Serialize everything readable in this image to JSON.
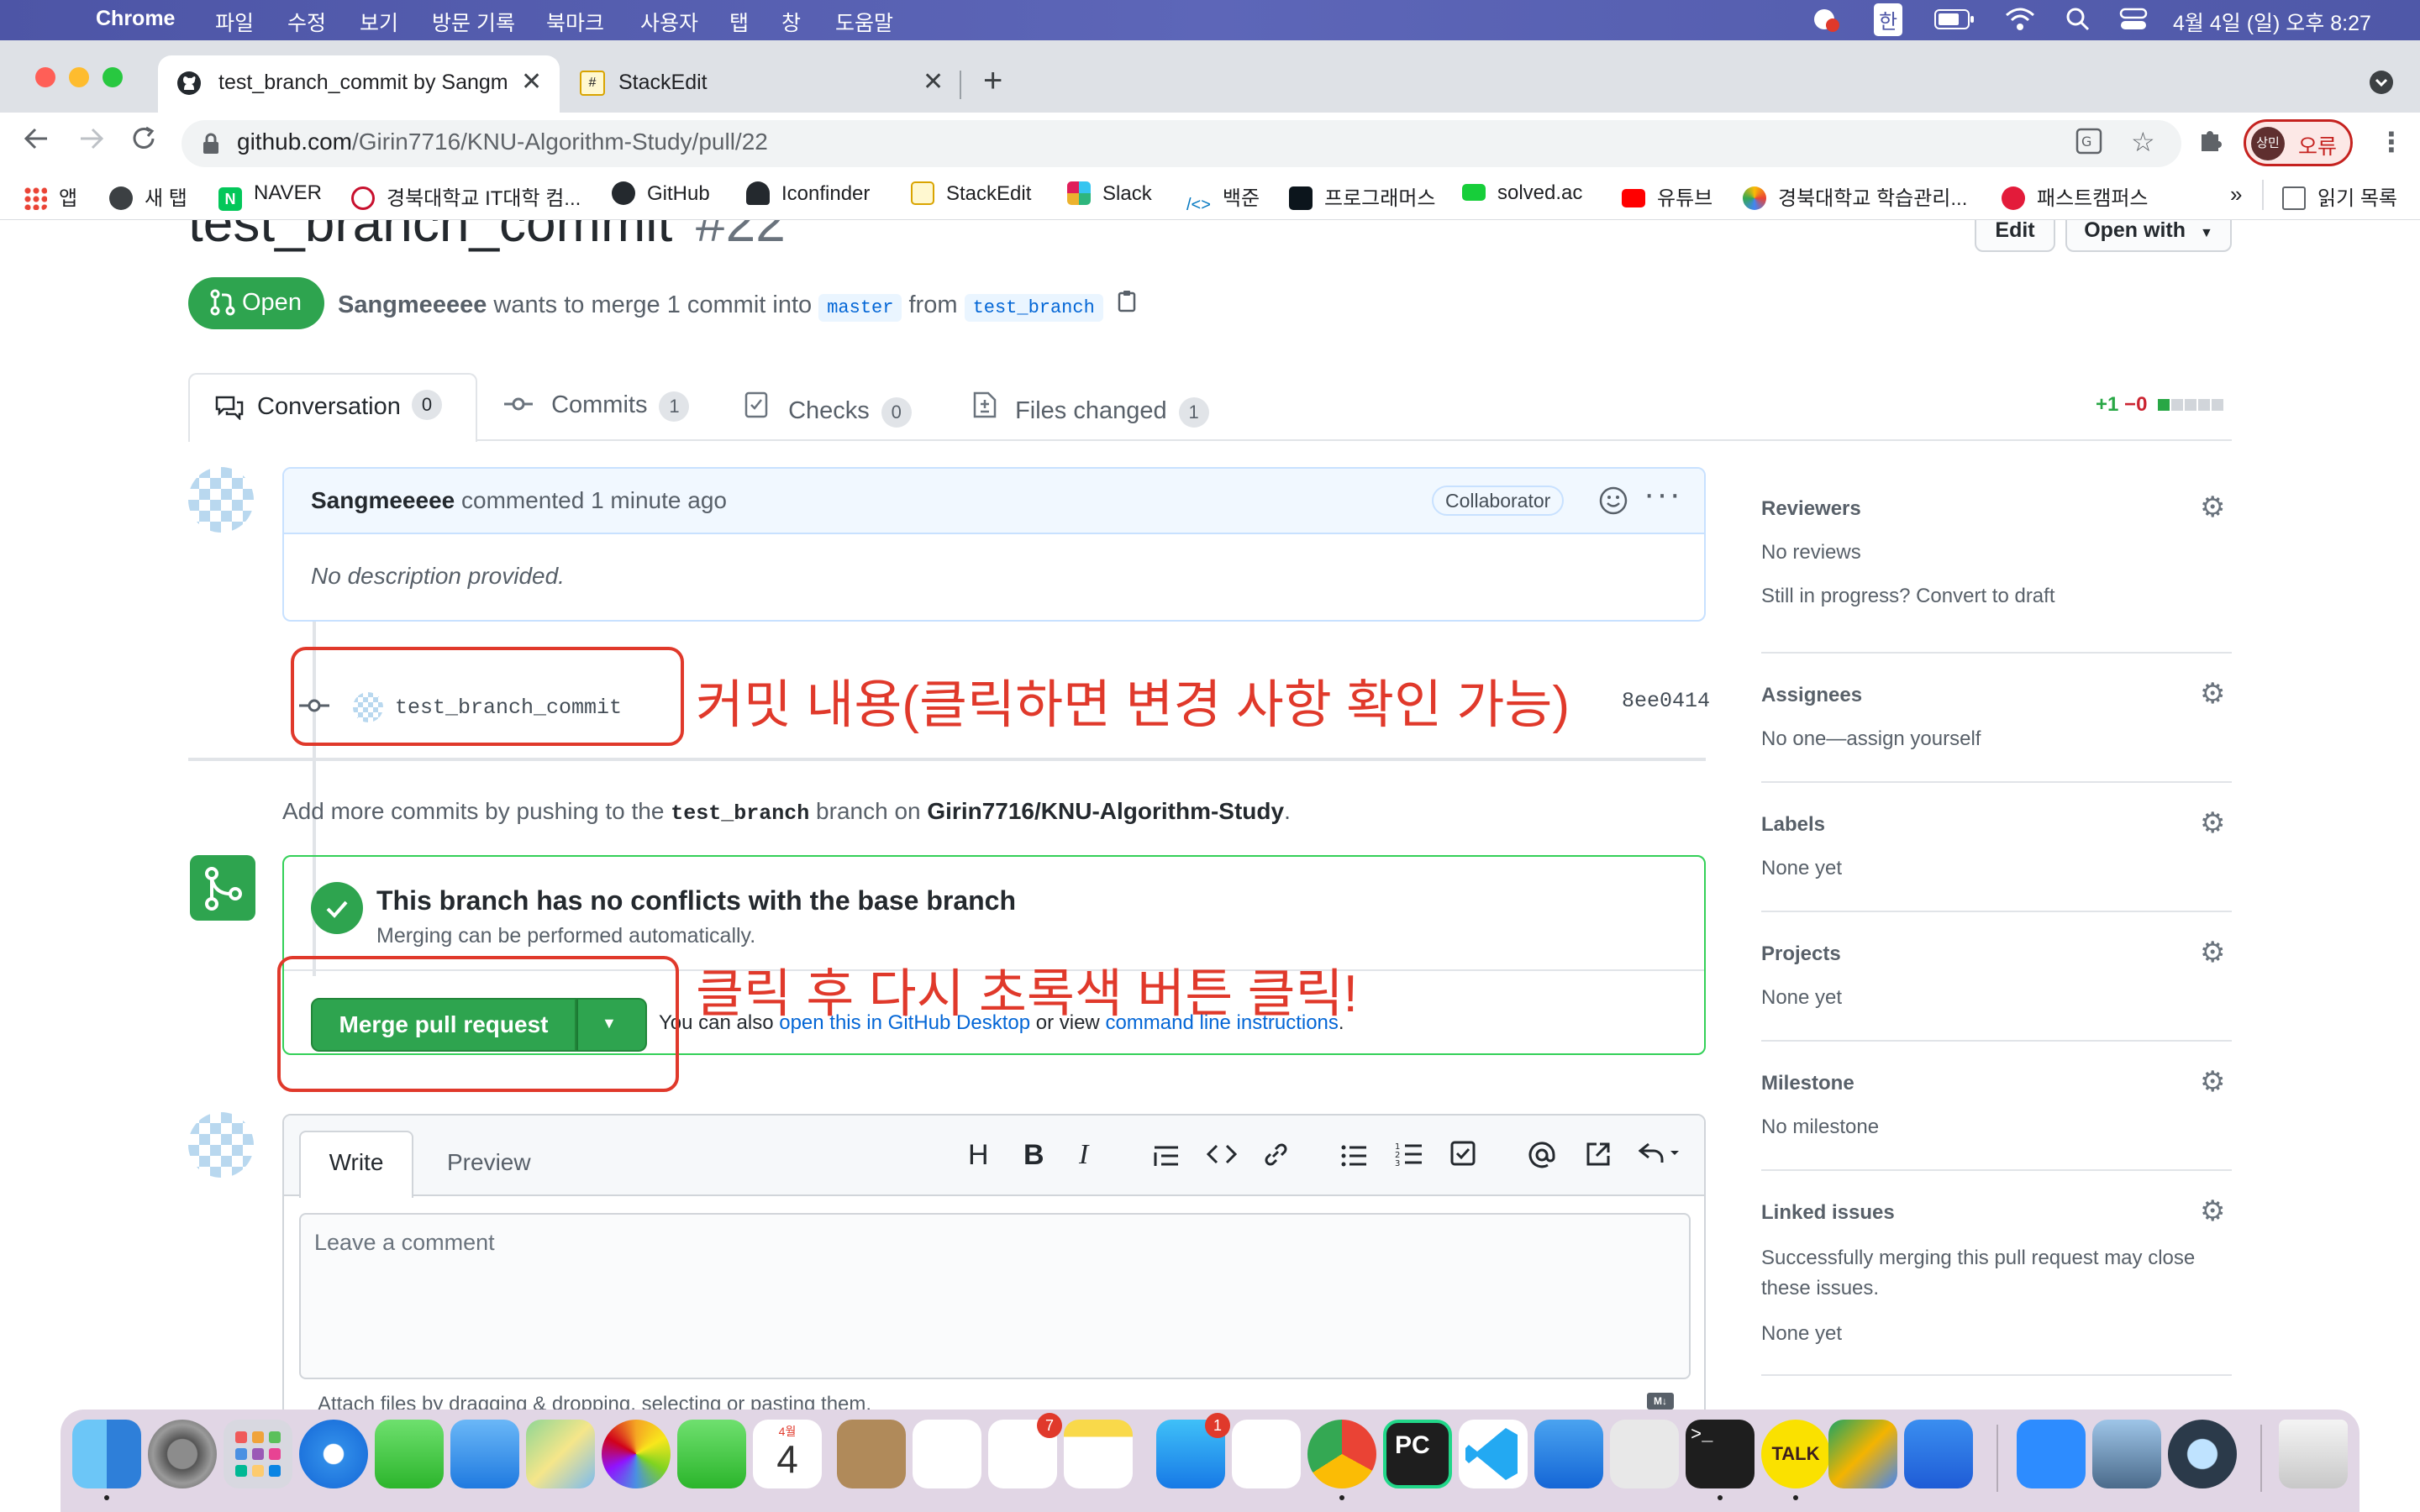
{
  "menubar": {
    "app": "Chrome",
    "items": [
      "파일",
      "수정",
      "보기",
      "방문 기록",
      "북마크",
      "사용자",
      "탭",
      "창",
      "도움말"
    ],
    "ime": "한",
    "clock": "4월 4일 (일) 오후 8:27"
  },
  "tabs": [
    {
      "title": "test_branch_commit by Sangm",
      "active": true
    },
    {
      "title": "StackEdit",
      "active": false
    }
  ],
  "address_bar": {
    "host": "github.com",
    "path": "/Girin7716/KNU-Algorithm-Study/pull/22"
  },
  "profile": {
    "avatar": "상민",
    "status": "오류"
  },
  "bookmarks": [
    "앱",
    "새 탭",
    "NAVER",
    "경북대학교 IT대학 컴...",
    "GitHub",
    "Iconfinder",
    "StackEdit",
    "Slack",
    "백준",
    "프로그래머스",
    "solved.ac",
    "유튜브",
    "경북대학교 학습관리...",
    "패스트캠퍼스"
  ],
  "bookmarks_overflow": "»",
  "reading_list": "읽기 목록",
  "pr": {
    "title": "test_branch_commit",
    "number": "#22",
    "edit_label": "Edit",
    "open_with_label": "Open with",
    "state": "Open",
    "author": "Sangmeeeee",
    "merge_text": "wants to merge 1 commit into",
    "base_branch": "master",
    "from_text": "from",
    "head_branch": "test_branch"
  },
  "tabnav": [
    {
      "label": "Conversation",
      "count": "0"
    },
    {
      "label": "Commits",
      "count": "1"
    },
    {
      "label": "Checks",
      "count": "0"
    },
    {
      "label": "Files changed",
      "count": "1"
    }
  ],
  "diffstat": {
    "added": "+1",
    "removed": "−0"
  },
  "comment": {
    "author": "Sangmeeeee",
    "action": "commented",
    "time": "1 minute ago",
    "badge": "Collaborator",
    "body": "No description provided."
  },
  "commit": {
    "message": "test_branch_commit",
    "sha": "8ee0414"
  },
  "push_hint": {
    "prefix": "Add more commits by pushing to the",
    "branch": "test_branch",
    "middle": "branch on",
    "repo": "Girin7716/KNU-Algorithm-Study",
    "suffix": "."
  },
  "merge_box": {
    "title": "This branch has no conflicts with the base branch",
    "subtitle": "Merging can be performed automatically.",
    "button": "Merge pull request",
    "also_text": "You can also",
    "desktop_link": "open this in GitHub Desktop",
    "or_view": "or view",
    "cli_link": "command line instructions",
    "end": "."
  },
  "annotations": {
    "commit": "커밋 내용(클릭하면 변경 사항 확인 가능)",
    "merge": "클릭 후 다시 초록색 버튼 클릭!"
  },
  "editor": {
    "write_tab": "Write",
    "preview_tab": "Preview",
    "placeholder": "Leave a comment",
    "attach_hint": "Attach files by dragging & dropping, selecting or pasting them."
  },
  "sidebar": {
    "reviewers": {
      "label": "Reviewers",
      "value": "No reviews",
      "extra": "Still in progress? Convert to draft"
    },
    "assignees": {
      "label": "Assignees",
      "value": "No one—assign yourself"
    },
    "labels": {
      "label": "Labels",
      "value": "None yet"
    },
    "projects": {
      "label": "Projects",
      "value": "None yet"
    },
    "milestone": {
      "label": "Milestone",
      "value": "No milestone"
    },
    "linked_issues": {
      "label": "Linked issues",
      "value": "Successfully merging this pull request may close these issues.",
      "extra": "None yet"
    }
  },
  "dock_badges": {
    "reminders": "7",
    "appstore": "1"
  },
  "calendar_icon": {
    "month": "4월",
    "day": "4"
  },
  "kakao_label": "TALK",
  "pycharm_label": "PC",
  "colors": {
    "gh_green": "#2ea44f",
    "annotation_red": "#e0392b",
    "link_blue": "#0366d6"
  }
}
